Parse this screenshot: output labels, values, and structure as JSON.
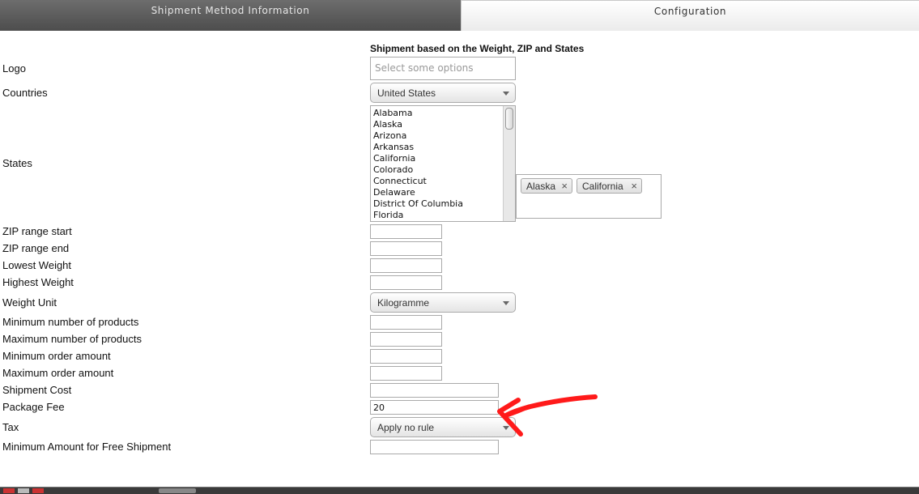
{
  "tabs": {
    "shipment_method_information": "Shipment Method Information",
    "configuration": "Configuration"
  },
  "form": {
    "header": "Shipment based on the Weight, ZIP and States",
    "logo": {
      "label": "Logo",
      "placeholder": "Select some options"
    },
    "countries": {
      "label": "Countries",
      "selected": "United States"
    },
    "states": {
      "label": "States",
      "options": [
        "Alabama",
        "Alaska",
        "Arizona",
        "Arkansas",
        "California",
        "Colorado",
        "Connecticut",
        "Delaware",
        "District Of Columbia",
        "Florida"
      ],
      "selected": [
        "Alaska",
        "California"
      ],
      "remove_glyph": "×"
    },
    "zip_range_start": {
      "label": "ZIP range start",
      "value": ""
    },
    "zip_range_end": {
      "label": "ZIP range end",
      "value": ""
    },
    "lowest_weight": {
      "label": "Lowest Weight",
      "value": ""
    },
    "highest_weight": {
      "label": "Highest Weight",
      "value": ""
    },
    "weight_unit": {
      "label": "Weight Unit",
      "selected": "Kilogramme"
    },
    "min_products": {
      "label": "Minimum number of products",
      "value": ""
    },
    "max_products": {
      "label": "Maximum number of products",
      "value": ""
    },
    "min_order_amount": {
      "label": "Minimum order amount",
      "value": ""
    },
    "max_order_amount": {
      "label": "Maximum order amount",
      "value": ""
    },
    "shipment_cost": {
      "label": "Shipment Cost",
      "value": ""
    },
    "package_fee": {
      "label": "Package Fee",
      "value": "20"
    },
    "tax": {
      "label": "Tax",
      "selected": "Apply no rule"
    },
    "min_free_shipment": {
      "label": "Minimum Amount for Free Shipment",
      "value": ""
    }
  },
  "colors": {
    "annotation_arrow": "#ff1a1a",
    "active_tab": "#5a5a5a"
  }
}
